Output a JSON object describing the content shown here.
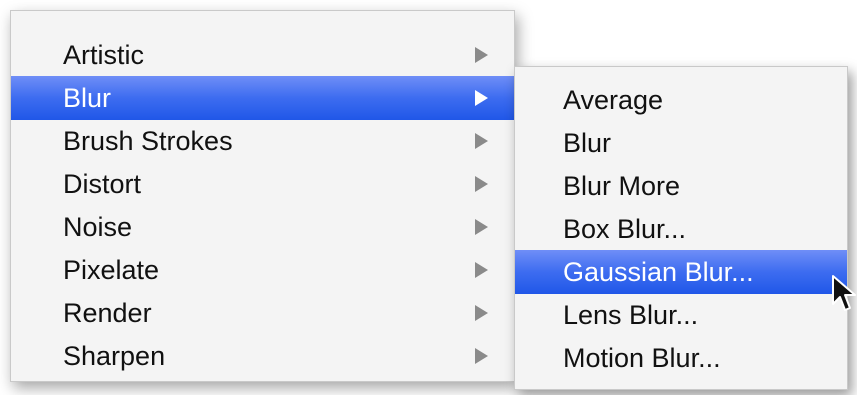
{
  "main_menu": {
    "items": [
      {
        "label": "Artistic",
        "selected": false
      },
      {
        "label": "Blur",
        "selected": true
      },
      {
        "label": "Brush Strokes",
        "selected": false
      },
      {
        "label": "Distort",
        "selected": false
      },
      {
        "label": "Noise",
        "selected": false
      },
      {
        "label": "Pixelate",
        "selected": false
      },
      {
        "label": "Render",
        "selected": false
      },
      {
        "label": "Sharpen",
        "selected": false
      }
    ],
    "submenu_arrow_icon": "triangle-right-icon"
  },
  "sub_menu": {
    "items": [
      {
        "label": "Average",
        "selected": false
      },
      {
        "label": "Blur",
        "selected": false
      },
      {
        "label": "Blur More",
        "selected": false
      },
      {
        "label": "Box Blur...",
        "selected": false
      },
      {
        "label": "Gaussian Blur...",
        "selected": true
      },
      {
        "label": "Lens Blur...",
        "selected": false
      },
      {
        "label": "Motion Blur...",
        "selected": false
      }
    ]
  },
  "cursor_icon": "arrow-cursor-icon",
  "colors": {
    "menu_background": "#f4f4f4",
    "highlight": "#3d6cf0",
    "text": "#111111",
    "highlight_text": "#ffffff",
    "arrow": "#8a8a8a"
  }
}
